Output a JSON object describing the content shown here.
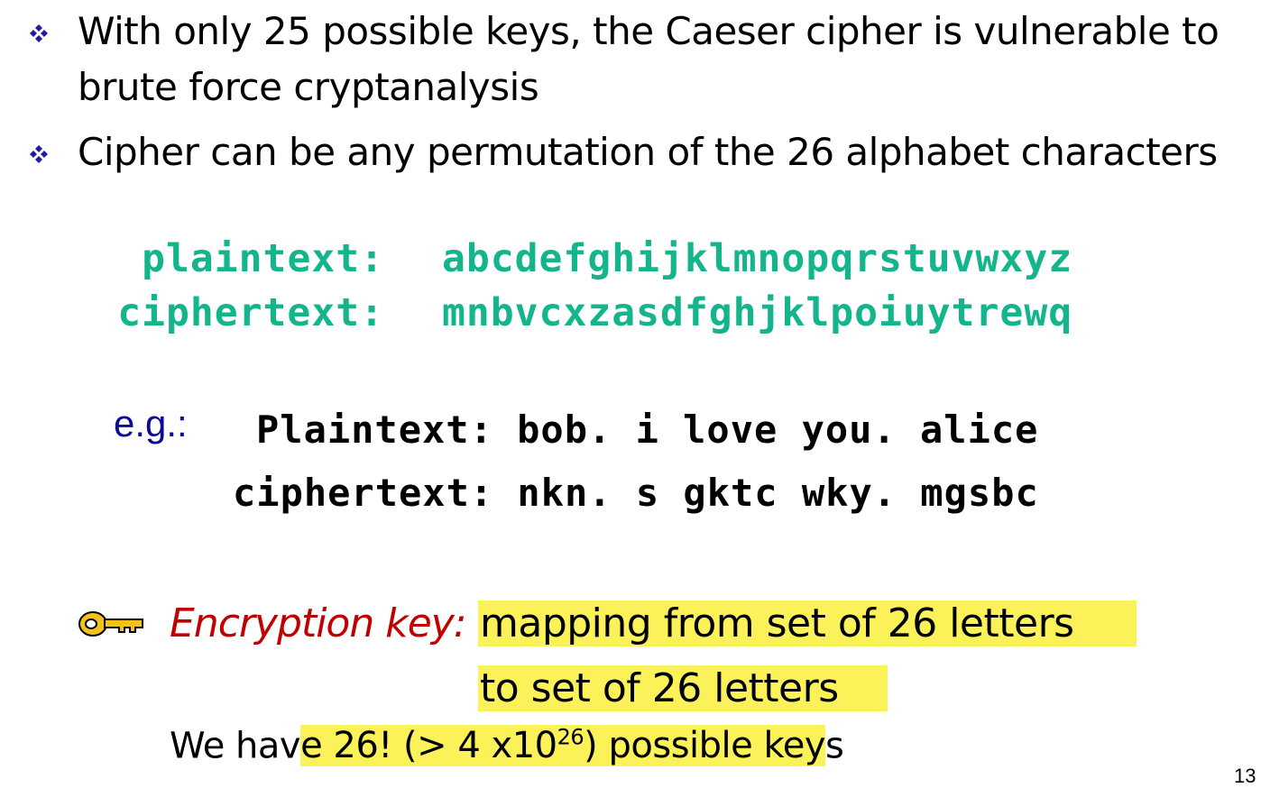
{
  "bullets": [
    {
      "icon": "diamond-bullet-icon",
      "line1": "With only 25 possible keys, the Caeser cipher is vulnerable to",
      "line2": "brute force cryptanalysis"
    },
    {
      "icon": "diamond-bullet-icon",
      "line1": "Cipher can be any permutation of the 26 alphabet characters"
    }
  ],
  "mapping": {
    "plain_label": "plaintext:",
    "plain_value": "abcdefghijklmnopqrstuvwxyz",
    "cipher_label": "ciphertext:",
    "cipher_value": "mnbvcxzasdfghjklpoiuytrewq"
  },
  "example": {
    "eg_label": "e.g.:",
    "plain_line": "Plaintext: bob. i love you. alice",
    "cipher_line": "ciphertext: nkn. s gktc wky. mgsbc"
  },
  "key": {
    "icon": "key-icon",
    "label": "Encryption key:",
    "line1": "mapping from set of 26 letters",
    "line2": "to set of 26 letters"
  },
  "keys_count": {
    "prefix": "We hav",
    "hl_start": "e 26! (> 4 x10",
    "superscript": "26",
    "hl_end": ") possible key",
    "suffix": "s"
  },
  "page_number": "13",
  "colors": {
    "teal": "#14b58c",
    "navy": "#0a0a99",
    "red": "#c00000",
    "highlight": "#fbf259",
    "bullet": "#1f1f9e"
  }
}
